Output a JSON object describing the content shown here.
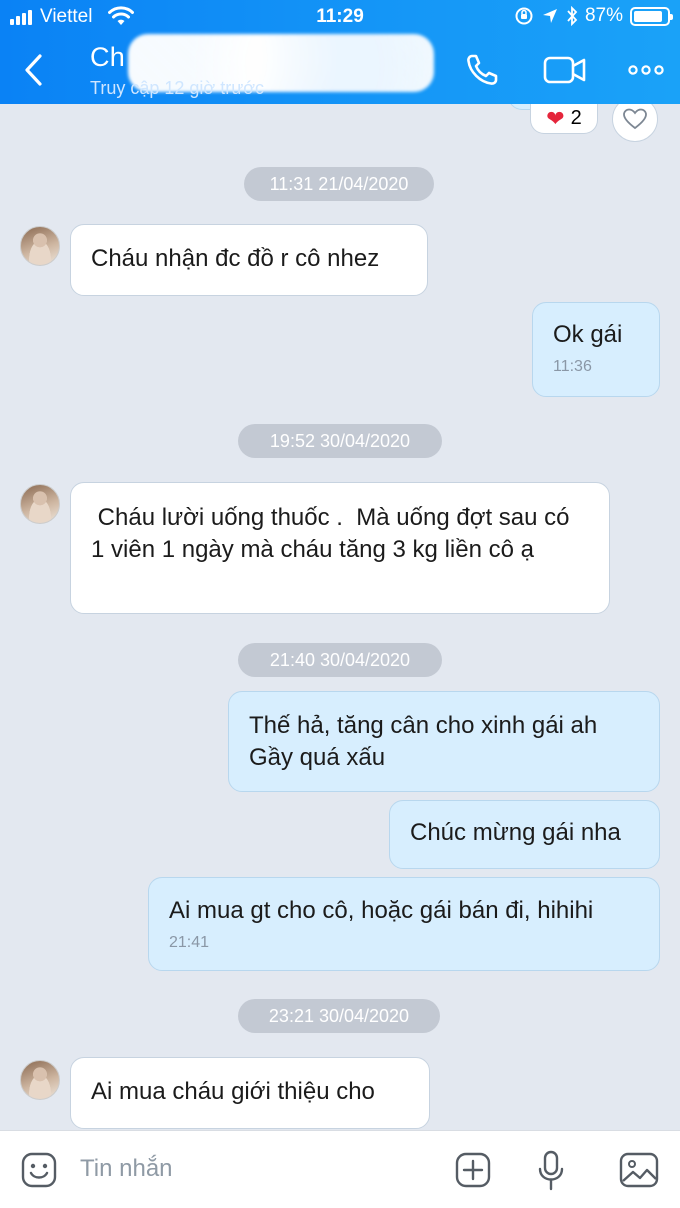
{
  "status_bar": {
    "carrier": "Viettel",
    "time": "11:29",
    "battery_percent": "87%",
    "battery_level": 0.87
  },
  "header": {
    "contact_name_visible": "Ch",
    "last_seen": "Truy cập 12 giờ trước",
    "icons": [
      "back-chevron-icon",
      "phone-icon",
      "video-call-icon",
      "more-icon"
    ]
  },
  "reaction": {
    "emoji": "❤",
    "count": "2"
  },
  "messages": [
    {
      "type": "time",
      "text": "11:31 21/04/2020"
    },
    {
      "type": "in",
      "text": "Cháu nhận đc đồ r cô nhez"
    },
    {
      "type": "out",
      "text": "Ok gái",
      "time": "11:36"
    },
    {
      "type": "time",
      "text": "19:52 30/04/2020"
    },
    {
      "type": "in",
      "text": " Cháu lười uống thuốc .  Mà uống đợt sau có 1 viên 1 ngày mà cháu tăng 3 kg liền cô ạ"
    },
    {
      "type": "time",
      "text": "21:40 30/04/2020"
    },
    {
      "type": "out",
      "text": "Thế hả, tăng cân cho xinh gái ah Gầy quá xấu"
    },
    {
      "type": "out",
      "text": "Chúc mừng gái nha"
    },
    {
      "type": "out",
      "text": "Ai mua gt cho cô, hoặc gái bán đi, hihihi",
      "time": "21:41"
    },
    {
      "type": "time",
      "text": "23:21 30/04/2020"
    },
    {
      "type": "in",
      "text": "Ai mua cháu giới thiệu cho"
    }
  ],
  "composer": {
    "placeholder": "Tin nhắn",
    "icons": [
      "sticker-icon",
      "add-icon",
      "microphone-icon",
      "image-icon"
    ]
  },
  "colors": {
    "header": "#1597f7",
    "chat_bg": "#e3e8f0",
    "bubble_in": "#ffffff",
    "bubble_out": "#d7eefe",
    "time_pill": "#c3c9d3"
  }
}
